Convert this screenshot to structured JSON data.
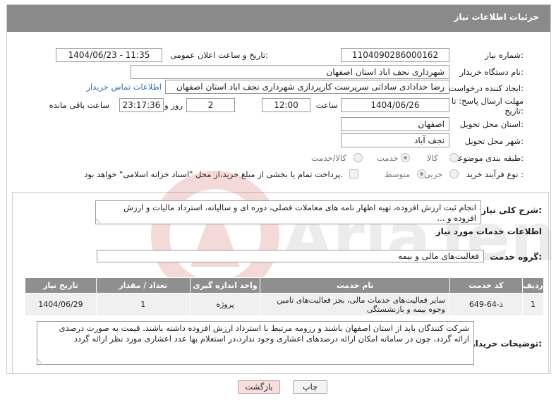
{
  "header": {
    "title": "جزئیات اطلاعات نیاز"
  },
  "fields": {
    "need_number_label": "شماره نیاز:",
    "need_number": "1104090286000162",
    "announce_label": "تاریخ و ساعت اعلان عمومی:",
    "announce_value": "1404/06/23 - 11:35",
    "buyer_org_label": "نام دستگاه خریدار:",
    "buyer_org": "شهرداری نجف اباد استان اصفهان",
    "creator_label": "ایجاد کننده درخواست:",
    "creator": "رضا خدادادی ساداتی سرپرست  کارپردازی شهرداری نجف اباد استان اصفهان",
    "contact_link": "اطلاعات تماس خریدار",
    "deadline_label_1": "مهلت ارسال پاسخ: تا",
    "deadline_label_2": "تاریخ:",
    "deadline_date": "1404/06/26",
    "time_label": "ساعت",
    "deadline_time": "12:00",
    "days_value": "2",
    "days_label": "روز و",
    "remaining_time": "23:17:36",
    "remaining_label": "ساعت باقی مانده",
    "province_label": "استان محل تحویل:",
    "province": "اصفهان",
    "city_label": "شهر محل تحویل:",
    "city": "نجف آباد",
    "category_label": "طبقه بندی موضوعی:",
    "category_options": [
      "کالا",
      "خدمت",
      "کالا/خدمت"
    ],
    "category_selected": "خدمت",
    "process_label": "نوع فرآیند خرید :",
    "process_options": [
      "جزیی",
      "متوسط"
    ],
    "process_selected": "متوسط",
    "treasury_text": "پرداخت تمام یا بخشی از مبلغ خرید،از محل \"اسناد خزانه اسلامی\" خواهد بود."
  },
  "summary": {
    "label": "شرح کلی نیاز:",
    "text": "انجام ثبت ارزش افزوده، تهیه اظهار نامه های معاملات فصلی، دوره ای و سالیانه، استرداد مالیات و ارزش افزوده و ..."
  },
  "services": {
    "section_title": "اطلاعات خدمات مورد نیاز",
    "group_label": "گروه خدمت:",
    "group_value": "فعالیت‌های مالی و بیمه",
    "columns": [
      "ردیف",
      "کد خدمت",
      "نام خدمت",
      "واحد اندازه گیری",
      "تعداد / مقدار",
      "تاریخ نیاز"
    ],
    "rows": [
      [
        "1",
        "ذ-64-649",
        "سایر فعالیت‌های خدمات مالی، بجز فعالیت‌های تامین وجوه بیمه و بازنشستگی",
        "پروژه",
        "1",
        "1404/06/29"
      ]
    ]
  },
  "buyer_notes": {
    "label": "توضیحات خریدار:",
    "text": "شرکت کنندگان باید از استان اصفهان باشند و رزومه مرتبط با استرداد ارزش افزوده داشته باشند. قیمت به صورت درصدی ارائه گردد، چون در سامانه امکان ارائه درصدهای اعشاری وجود ندارد،در استعلام بها عدد اعشاری مورد نظر ارائه گردد"
  },
  "buttons": {
    "print": "چاپ",
    "back": "بازگشت"
  },
  "colors": {
    "header_bg": "#8a8a8a",
    "link": "#2a6fb8",
    "back_button": "#f8dede",
    "watermark": "#c0392b"
  },
  "icons": {
    "watermark": "ariatender-watermark-logo"
  }
}
